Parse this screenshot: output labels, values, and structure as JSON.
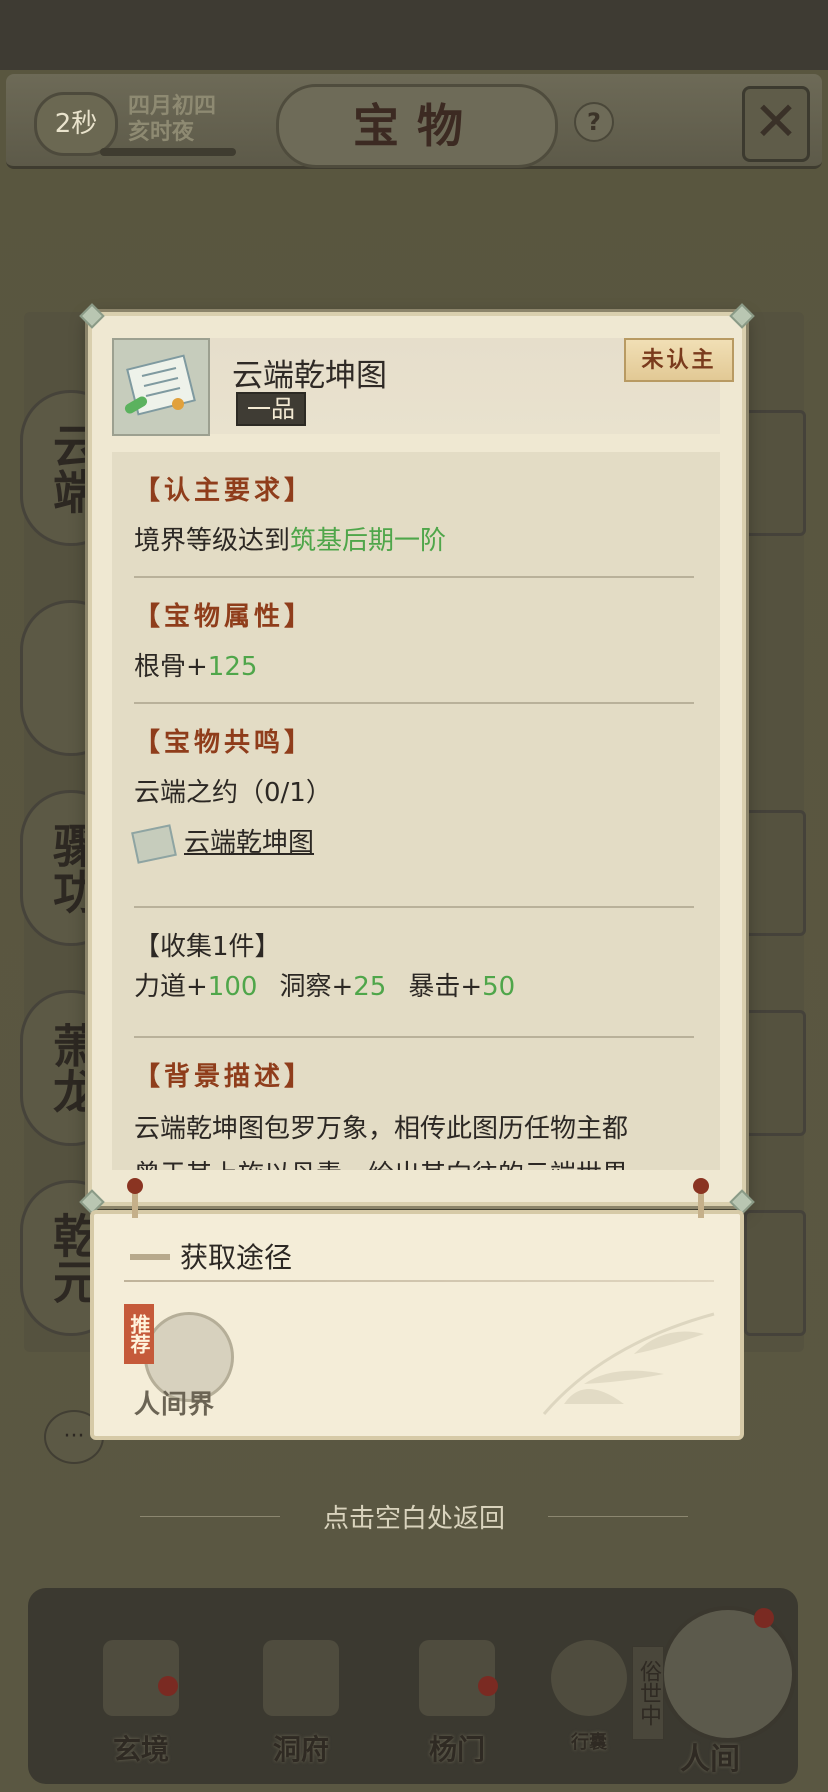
{
  "background": {
    "timer": "2秒",
    "date_line1": "四月初四",
    "date_line2": "亥时夜",
    "page_title": "宝物",
    "help_icon": "question-icon",
    "close_icon": "close-icon",
    "nav": [
      {
        "label": "玄境",
        "icon": "scroll-icon"
      },
      {
        "label": "洞府",
        "icon": "pagoda-icon"
      },
      {
        "label": "杨门",
        "icon": "banner-icon"
      },
      {
        "label": "行囊",
        "icon": "bag-icon"
      },
      {
        "label": "人间",
        "icon": "mountain-icon"
      }
    ],
    "human_tag": "俗世中"
  },
  "item": {
    "name": "云端乾坤图",
    "grade": "一品",
    "status": "未认主",
    "icon": "scroll-icon"
  },
  "sections": {
    "requirement_title": "【认主要求】",
    "requirement_prefix": "境界等级达到",
    "requirement_value": "筑基后期一阶",
    "attr_title": "【宝物属性】",
    "attr_label": "根骨+",
    "attr_value": "125",
    "resonance_title": "【宝物共鸣】",
    "resonance_name": "云端之约（0/1）",
    "resonance_item": "云端乾坤图",
    "collect_title": "【收集1件】",
    "collect": [
      {
        "label": "力道+",
        "value": "100"
      },
      {
        "label": "洞察+",
        "value": "25"
      },
      {
        "label": "暴击+",
        "value": "50"
      }
    ],
    "background_title": "【背景描述】",
    "background_line1": "云端乾坤图包罗万象，相传此图历任物主都",
    "background_line2": "曾于其上施以丹青，绘出其向往的云端世界"
  },
  "source": {
    "title": "获取途径",
    "route_tag": "推荐",
    "route_label": "人间界"
  },
  "hint": "点击空白处返回",
  "colors": {
    "section_title": "#8f3d1b",
    "green_value": "#4fa64a",
    "status_text": "#7a3b1d"
  }
}
